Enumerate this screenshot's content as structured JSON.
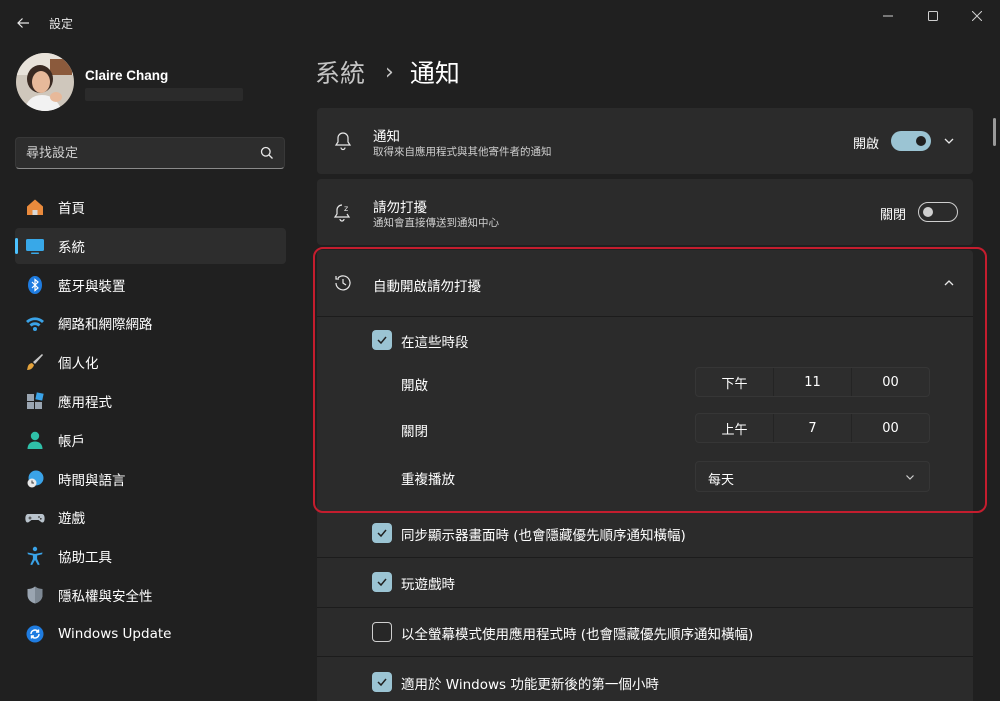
{
  "window": {
    "title": "設定"
  },
  "profile": {
    "name": "Claire Chang"
  },
  "search": {
    "placeholder": "尋找設定"
  },
  "sidebar": {
    "items": [
      {
        "label": "首頁",
        "icon": "home-icon"
      },
      {
        "label": "系統",
        "icon": "monitor-icon",
        "active": true
      },
      {
        "label": "藍牙與裝置",
        "icon": "bluetooth-icon"
      },
      {
        "label": "網路和網際網路",
        "icon": "wifi-icon"
      },
      {
        "label": "個人化",
        "icon": "paintbrush-icon"
      },
      {
        "label": "應用程式",
        "icon": "apps-icon"
      },
      {
        "label": "帳戶",
        "icon": "person-icon"
      },
      {
        "label": "時間與語言",
        "icon": "clock-globe-icon"
      },
      {
        "label": "遊戲",
        "icon": "gamepad-icon"
      },
      {
        "label": "協助工具",
        "icon": "accessibility-icon"
      },
      {
        "label": "隱私權與安全性",
        "icon": "shield-icon"
      },
      {
        "label": "Windows Update",
        "icon": "refresh-icon"
      }
    ]
  },
  "breadcrumb": {
    "parent": "系統",
    "separator": "›",
    "current": "通知"
  },
  "notifications": {
    "title": "通知",
    "subtitle": "取得來自應用程式與其他寄件者的通知",
    "state_label": "開啟",
    "on": true
  },
  "dnd": {
    "title": "請勿打擾",
    "subtitle": "通知會直接傳送到通知中心",
    "state_label": "關閉",
    "on": false
  },
  "auto_dnd": {
    "title": "自動開啟請勿打擾",
    "during_times": {
      "label": "在這些時段",
      "checked": true
    },
    "start": {
      "label": "開啟",
      "period": "下午",
      "hour": "11",
      "minute": "00"
    },
    "end": {
      "label": "關閉",
      "period": "上午",
      "hour": "7",
      "minute": "00"
    },
    "repeat": {
      "label": "重複播放",
      "value": "每天"
    }
  },
  "options": [
    {
      "label": "同步顯示器畫面時 (也會隱藏優先順序通知橫幅)",
      "checked": true
    },
    {
      "label": "玩遊戲時",
      "checked": true
    },
    {
      "label": "以全螢幕模式使用應用程式時 (也會隱藏優先順序通知橫幅)",
      "checked": false
    },
    {
      "label": "適用於 Windows 功能更新後的第一個小時",
      "checked": true
    }
  ],
  "colors": {
    "accent": "#4cc2ff",
    "toggle_on": "#9bc4d3",
    "highlight_border": "#c41d2e"
  }
}
